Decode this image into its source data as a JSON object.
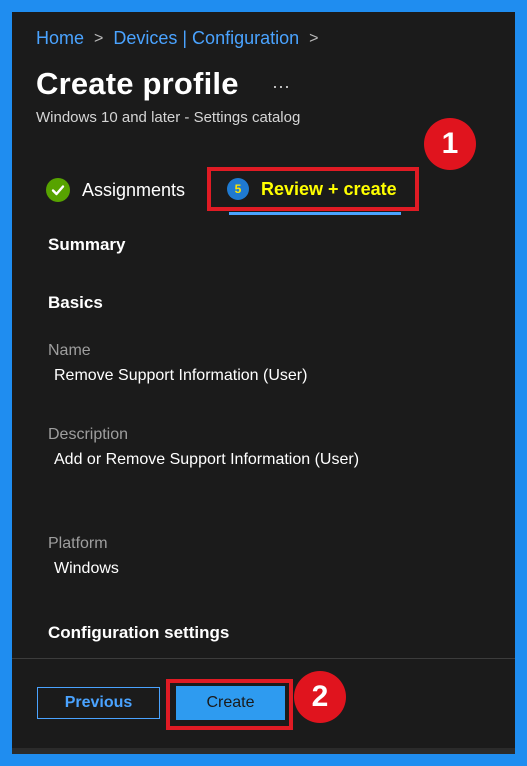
{
  "breadcrumb": {
    "home": "Home",
    "devices": "Devices | Configuration",
    "sep": ">"
  },
  "header": {
    "title": "Create profile",
    "more_label": "···",
    "subtitle": "Windows 10 and later - Settings catalog"
  },
  "tabs": {
    "assignments_label": "Assignments",
    "review_step": "5",
    "review_label": "Review + create"
  },
  "callouts": {
    "one": "1",
    "two": "2"
  },
  "summary": {
    "summary_heading": "Summary",
    "basics_heading": "Basics",
    "name_label": "Name",
    "name_value": "Remove Support Information (User)",
    "description_label": "Description",
    "description_value": "Add or Remove Support Information (User)",
    "platform_label": "Platform",
    "platform_value": "Windows",
    "config_heading": "Configuration settings"
  },
  "footer": {
    "previous_label": "Previous",
    "create_label": "Create"
  },
  "colors": {
    "accent": "#4aa3ff",
    "highlight": "#e01b24",
    "success": "#57a300",
    "review_text": "#ffff00"
  }
}
